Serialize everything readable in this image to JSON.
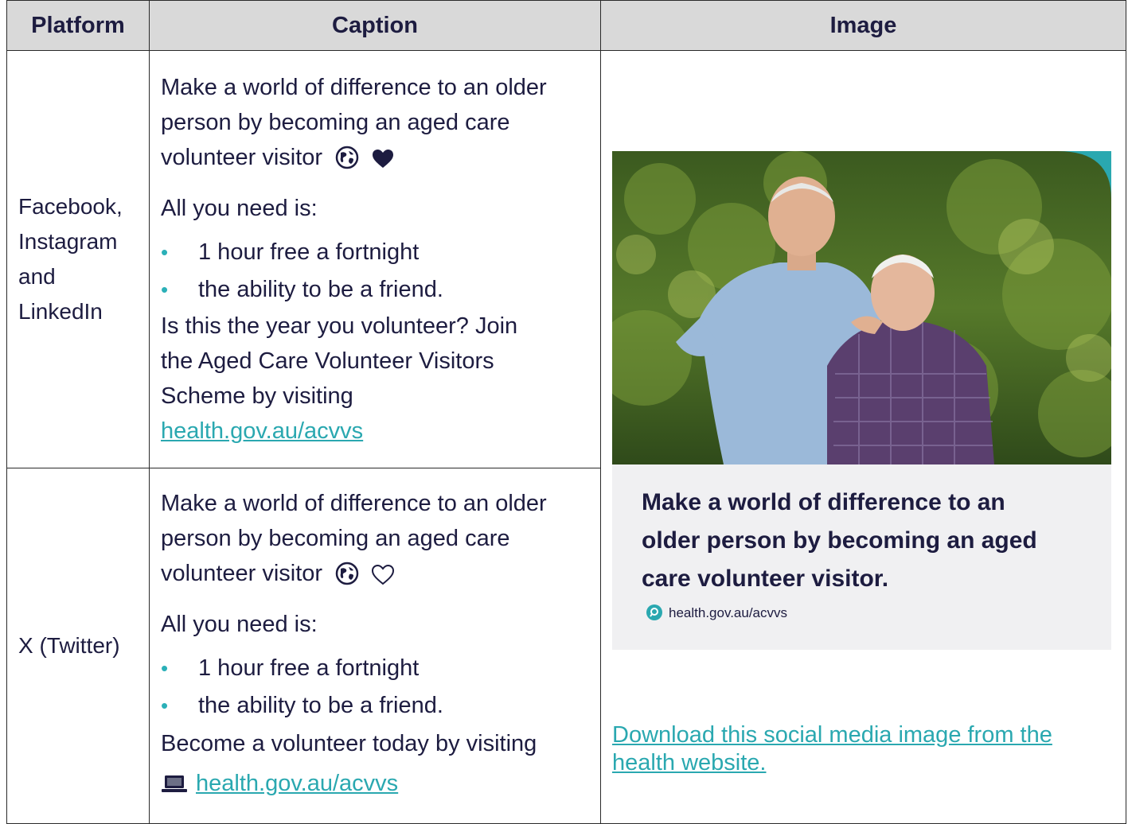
{
  "headers": {
    "platform": "Platform",
    "caption": "Caption",
    "image": "Image"
  },
  "rows": [
    {
      "platform_lines": [
        "Facebook,",
        "Instagram",
        "and",
        "LinkedIn"
      ],
      "caption_lines": [
        "Make a world of difference to an older",
        "person by becoming an aged care",
        "volunteer visitor"
      ],
      "emoji": [
        "globe-asia-icon",
        "black-heart-icon"
      ],
      "need": "All you need is:",
      "bullets": [
        "1 hour free a fortnight",
        "the ability to be a friend."
      ],
      "closing_lines": [
        "Is this the year you volunteer? Join",
        "the Aged Care Volunteer Visitors",
        "Scheme by visiting"
      ],
      "link": "health.gov.au/acvvs"
    },
    {
      "platform_lines": [
        "X (Twitter)"
      ],
      "caption_lines": [
        "Make a world of difference to an older",
        "person by becoming an aged care",
        "volunteer visitor"
      ],
      "emoji": [
        "globe-asia-icon",
        "white-heart-icon"
      ],
      "need": "All you need is:",
      "bullets": [
        "1 hour free a fortnight",
        "the ability to be a friend."
      ],
      "closing_lines": [
        "Become a volunteer today by visiting"
      ],
      "link_icon": "laptop-icon",
      "link": "health.gov.au/acvvs"
    }
  ],
  "promo": {
    "headline_lines": [
      "Make a world of difference to an",
      "older person by becoming an aged",
      "care volunteer visitor."
    ],
    "url": "health.gov.au/acvvs",
    "url_icon": "search-icon"
  },
  "download_link_lines": [
    "Download this social media image from the",
    "health website."
  ],
  "colors": {
    "accent": "#2aa8b0",
    "text": "#1d1c40",
    "header_bg": "#d9d9d9"
  }
}
